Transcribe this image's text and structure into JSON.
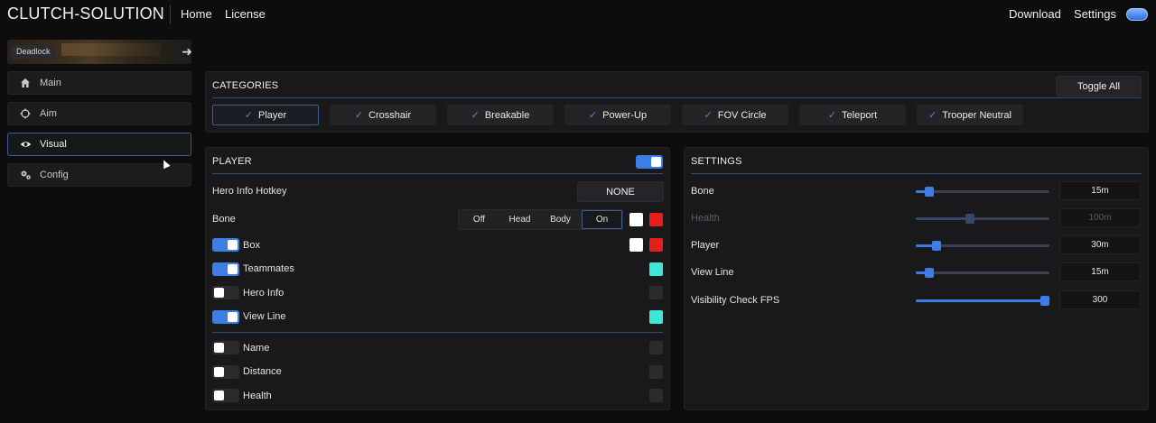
{
  "header": {
    "brand": "CLUTCH-SOLUTION",
    "nav": [
      "Home",
      "License"
    ],
    "right": [
      "Download",
      "Settings"
    ]
  },
  "game": {
    "label": "Deadlock"
  },
  "sidebar": {
    "items": [
      {
        "label": "Main",
        "icon": "home-icon",
        "active": false
      },
      {
        "label": "Aim",
        "icon": "crosshair-icon",
        "active": false
      },
      {
        "label": "Visual",
        "icon": "eye-icon",
        "active": true
      },
      {
        "label": "Config",
        "icon": "gears-icon",
        "active": false
      }
    ]
  },
  "categories": {
    "title": "CATEGORIES",
    "toggle_all": "Toggle All",
    "items": [
      {
        "label": "Player",
        "selected": true
      },
      {
        "label": "Crosshair",
        "selected": false
      },
      {
        "label": "Breakable",
        "selected": false
      },
      {
        "label": "Power-Up",
        "selected": false
      },
      {
        "label": "FOV Circle",
        "selected": false
      },
      {
        "label": "Teleport",
        "selected": false
      },
      {
        "label": "Trooper Neutral",
        "selected": false
      }
    ]
  },
  "player": {
    "title": "PLAYER",
    "enabled": true,
    "hotkey_label": "Hero Info Hotkey",
    "hotkey_value": "NONE",
    "bone_label": "Bone",
    "bone_options": [
      "Off",
      "Head",
      "Body",
      "On"
    ],
    "bone_selected": "On",
    "rows": [
      {
        "label": "Box",
        "on": true
      },
      {
        "label": "Teammates",
        "on": true
      },
      {
        "label": "Hero Info",
        "on": false
      },
      {
        "label": "View Line",
        "on": true
      },
      {
        "label": "Name",
        "on": false
      },
      {
        "label": "Distance",
        "on": false
      },
      {
        "label": "Health",
        "on": false
      }
    ],
    "colors": {
      "white": "#ffffff",
      "red": "#e81e1e",
      "cyan": "#3ee8d8",
      "empty": "#2b2b2e"
    }
  },
  "settings": {
    "title": "SETTINGS",
    "sliders": [
      {
        "label": "Bone",
        "value": "15m",
        "fraction": 0.07,
        "enabled": true
      },
      {
        "label": "Health",
        "value": "100m",
        "fraction": 0.4,
        "enabled": false
      },
      {
        "label": "Player",
        "value": "30m",
        "fraction": 0.13,
        "enabled": true
      },
      {
        "label": "View Line",
        "value": "15m",
        "fraction": 0.07,
        "enabled": true
      },
      {
        "label": "Visibility Check FPS",
        "value": "300",
        "fraction": 1.0,
        "enabled": true
      }
    ]
  }
}
